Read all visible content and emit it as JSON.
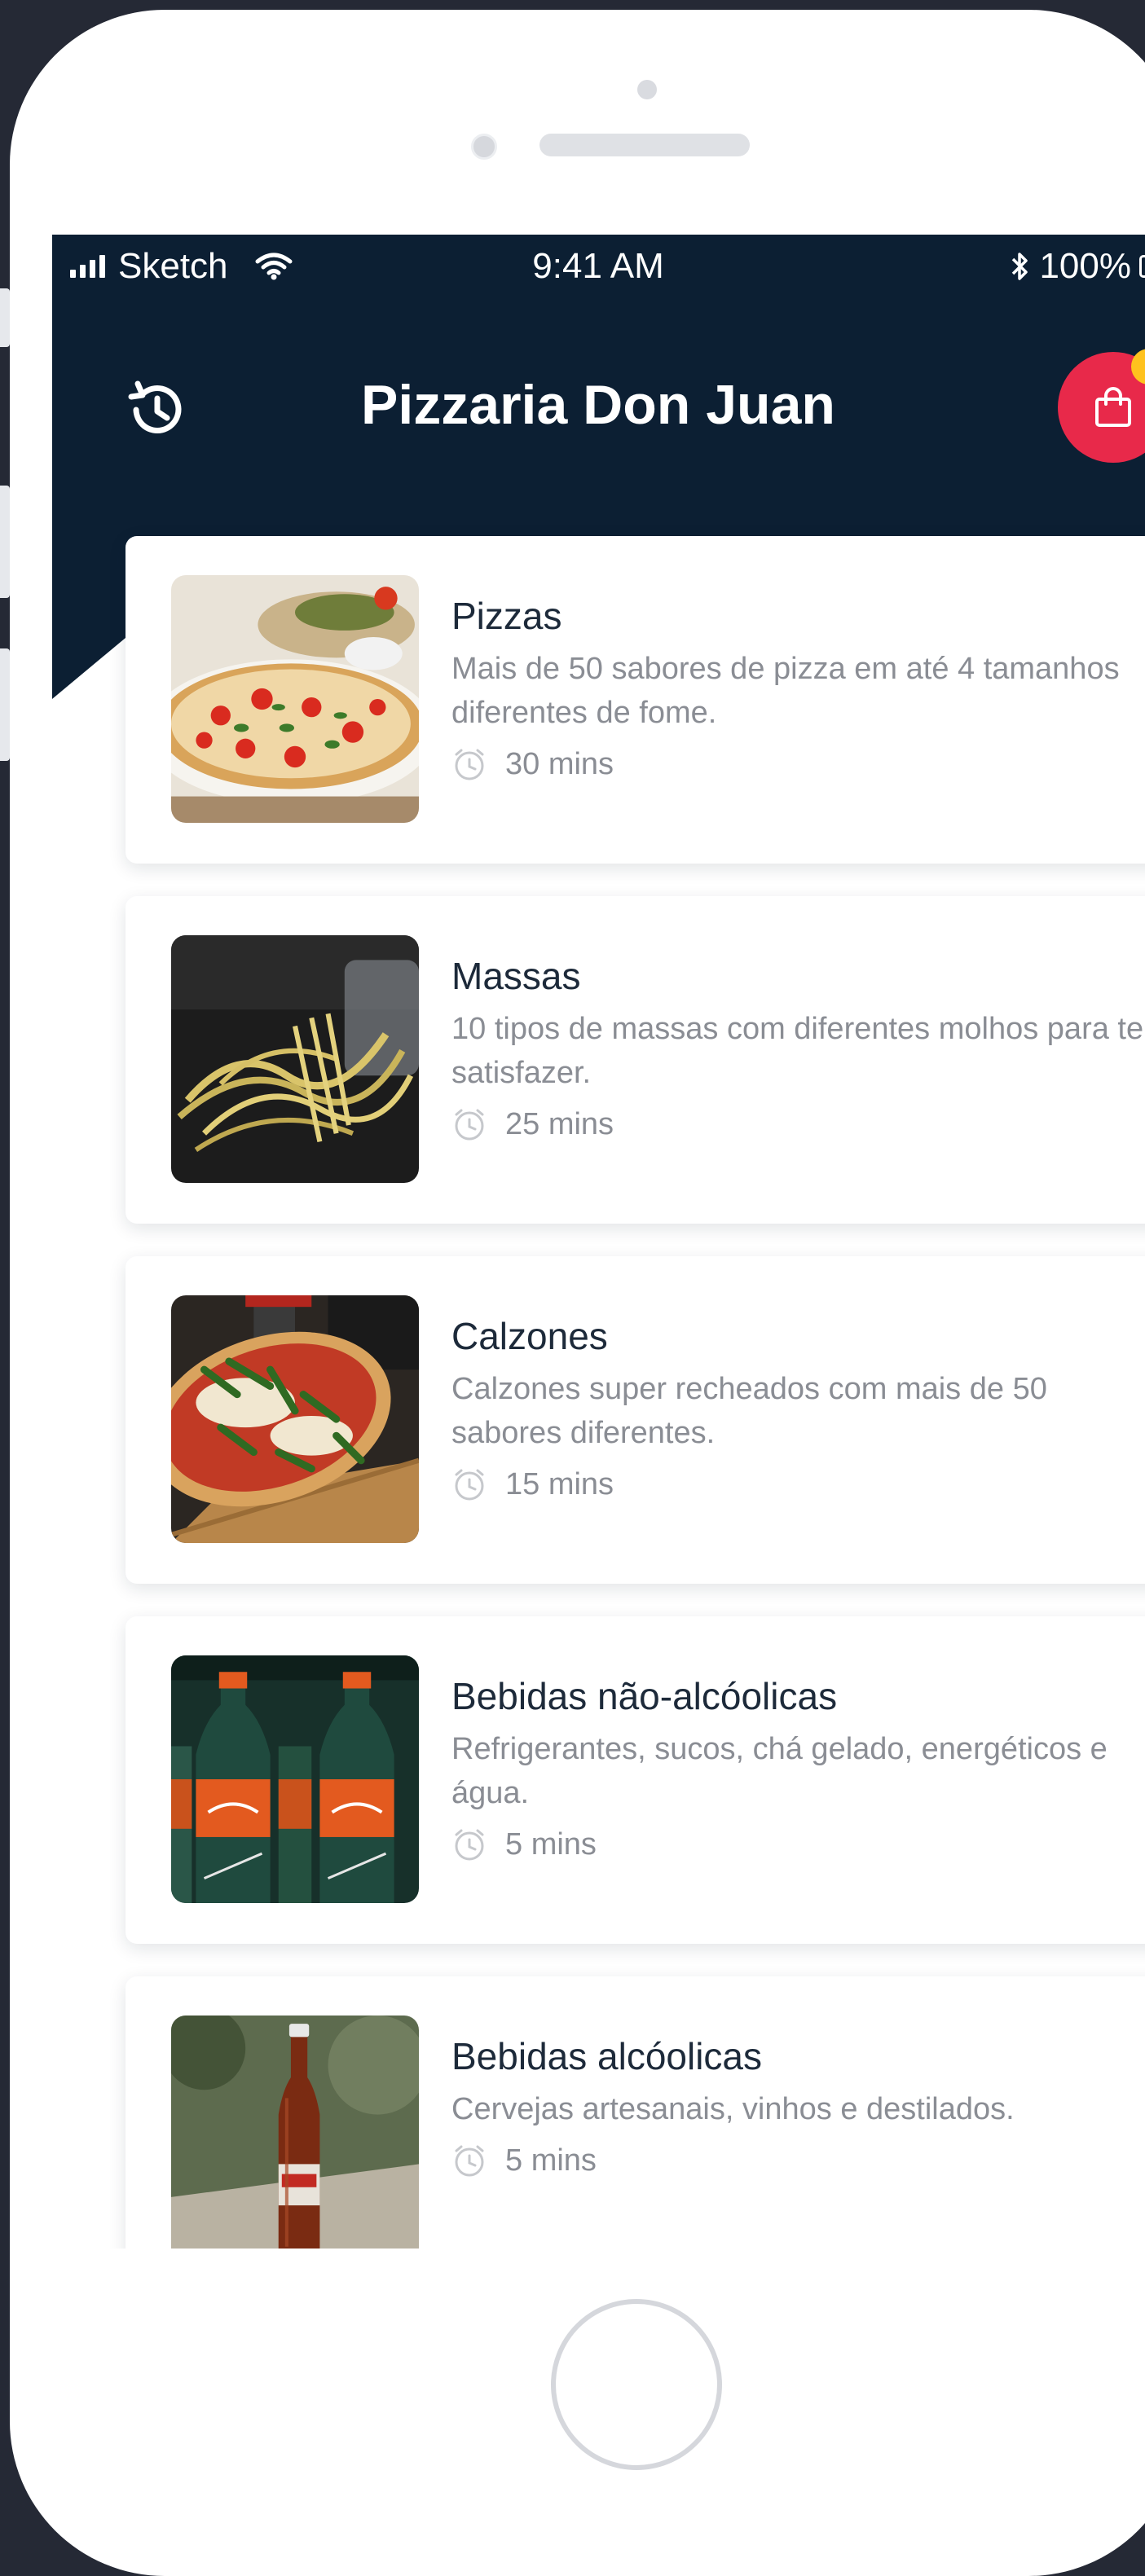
{
  "status_bar": {
    "carrier": "Sketch",
    "time": "9:41 AM",
    "battery": "100%"
  },
  "header": {
    "title": "Pizzaria Don Juan",
    "history_icon": "history-icon",
    "cart_icon": "shopping-bag-icon"
  },
  "colors": {
    "header_bg": "#0c1f33",
    "cart": "#e8294a",
    "badge": "#ffc21e"
  },
  "categories": [
    {
      "name": "Pizzas",
      "description": "Mais de 50 sabores de pizza em até 4 tamanhos diferentes de fome.",
      "time": "30 mins",
      "image": "pizza"
    },
    {
      "name": "Massas",
      "description": "10 tipos de massas com diferentes molhos para te satisfazer.",
      "time": "25 mins",
      "image": "pasta"
    },
    {
      "name": "Calzones",
      "description": "Calzones super recheados com mais de 50 sabores diferentes.",
      "time": "15 mins",
      "image": "calzone"
    },
    {
      "name": "Bebidas não-alcóolicas",
      "description": "Refrigerantes, sucos, chá gelado, energéticos e água.",
      "time": "5 mins",
      "image": "soda"
    },
    {
      "name": "Bebidas alcóolicas",
      "description": "Cervejas artesanais, vinhos e destilados.",
      "time": "5 mins",
      "image": "beer"
    }
  ]
}
